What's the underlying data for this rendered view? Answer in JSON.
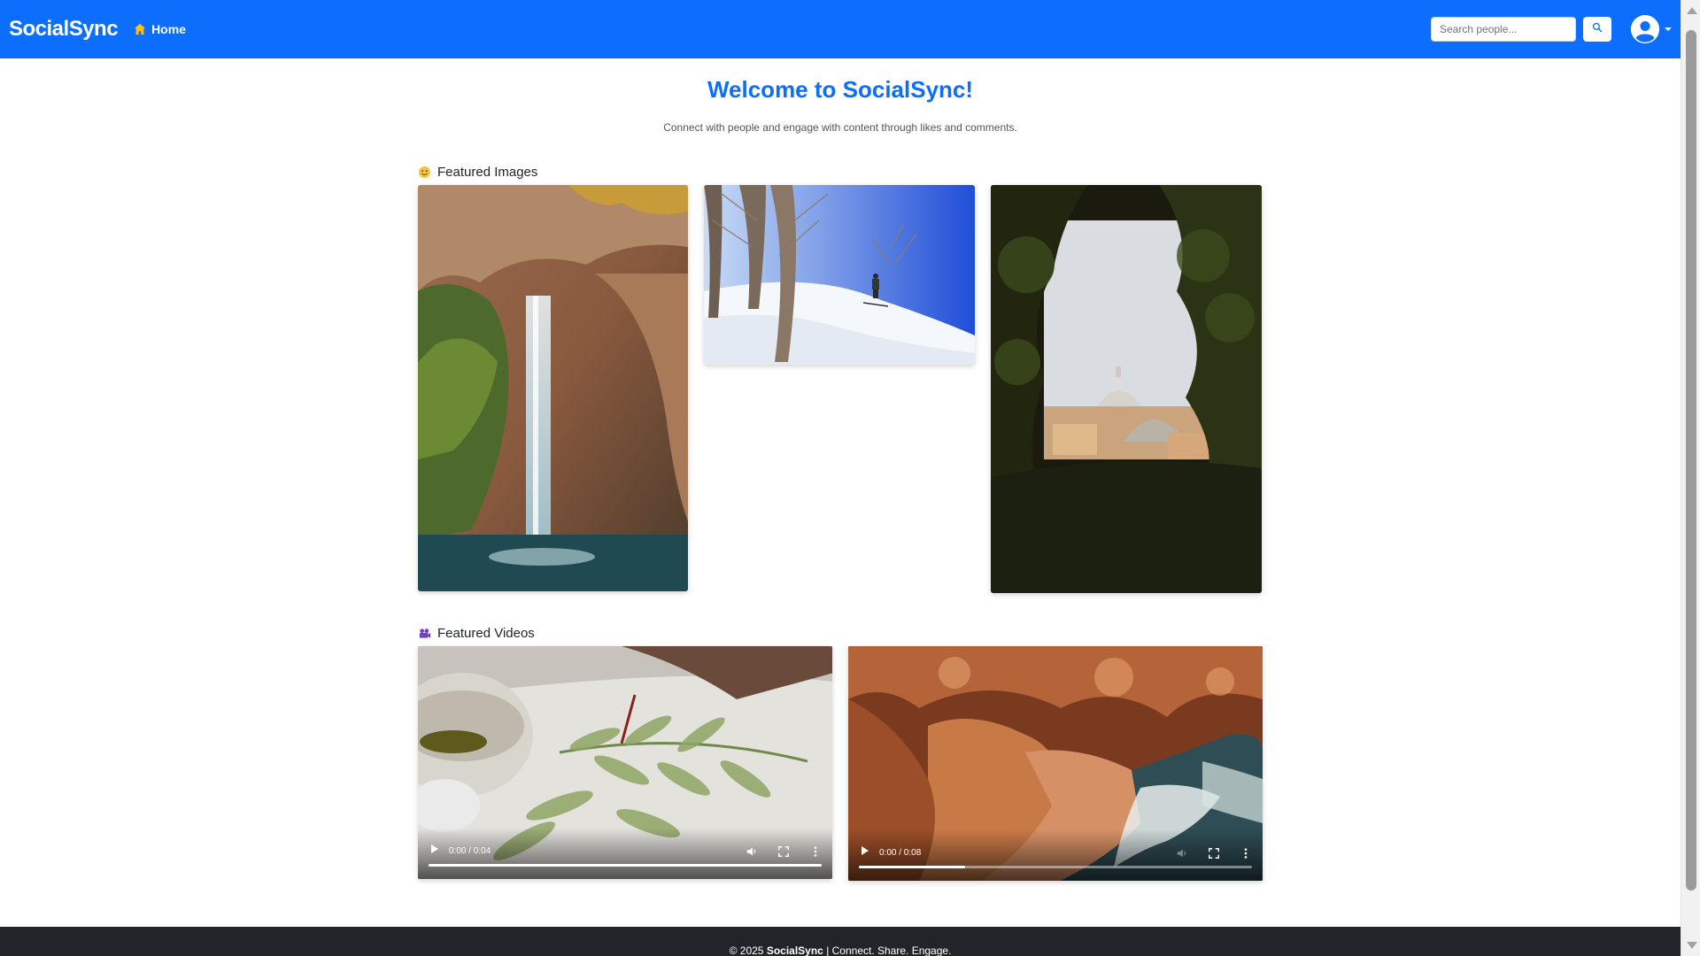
{
  "navbar": {
    "brand": "SocialSync",
    "home_label": "Home",
    "search_placeholder": "Search people...",
    "accent_color": "#0d6efd"
  },
  "hero": {
    "title": "Welcome to SocialSync!",
    "subtitle": "Connect with people and engage with content through likes and comments."
  },
  "featured_images": {
    "heading": "Featured Images",
    "items": [
      {
        "name": "waterfall-image"
      },
      {
        "name": "skier-snow-image"
      },
      {
        "name": "city-through-trees-image"
      }
    ]
  },
  "featured_videos": {
    "heading": "Featured Videos",
    "items": [
      {
        "name": "watercolor-painting-video",
        "time": "0:00 / 0:04",
        "progress": 1.0
      },
      {
        "name": "coastal-cliffs-video",
        "time": "0:00 / 0:08",
        "progress": 0.27
      }
    ]
  },
  "footer": {
    "copyright": "© 2025",
    "brand": "SocialSync",
    "tagline": "| Connect. Share. Engage."
  }
}
